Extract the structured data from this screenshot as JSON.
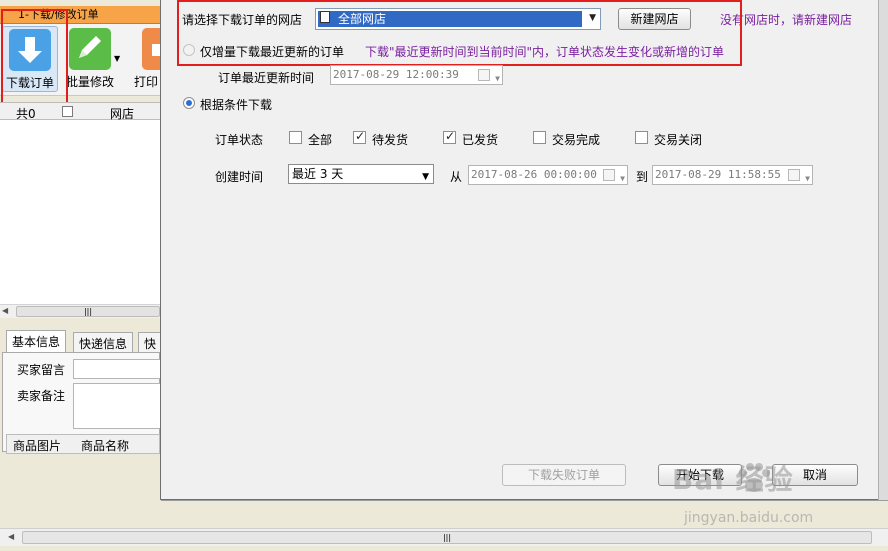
{
  "app": {
    "tab_title": "1-下载/修改订单",
    "toolbar": {
      "download_label": "下载订单",
      "batch_label": "批量修改",
      "print_label": "打印"
    },
    "list": {
      "count_label": "共0",
      "shop_col": "网店"
    },
    "info_tabs": [
      "基本信息",
      "快递信息",
      "快递"
    ],
    "info_fields": {
      "buyer_message": "买家留言",
      "seller_note": "卖家备注"
    },
    "product_cols": [
      "商品图片",
      "商品名称"
    ]
  },
  "dialog": {
    "shop_label": "请选择下载订单的网店",
    "shop_selected": "全部网店",
    "new_shop_button": "新建网店",
    "no_shop_hint": "没有网店时，请新建网店",
    "incremental_label": "仅增量下载最近更新的订单",
    "incremental_note": "下载\"最近更新时间到当前时间\"内，订单状态发生变化或新增的订单",
    "last_update_label": "订单最近更新时间",
    "last_update_value": "2017-08-29 12:00:39",
    "condition_label": "根据条件下载",
    "status_label": "订单状态",
    "statuses": [
      {
        "label": "全部",
        "checked": false
      },
      {
        "label": "待发货",
        "checked": true
      },
      {
        "label": "已发货",
        "checked": true
      },
      {
        "label": "交易完成",
        "checked": false
      },
      {
        "label": "交易关闭",
        "checked": false
      }
    ],
    "created_label": "创建时间",
    "range_value": "最近 3 天",
    "from_label": "从",
    "from_value": "2017-08-26 00:00:00",
    "to_label": "到",
    "to_value": "2017-08-29 11:58:55",
    "failed_button": "下载失败订单",
    "start_button": "开始下载",
    "cancel_button": "取消"
  },
  "watermark": {
    "logo": "Bai  经验",
    "url": "jingyan.baidu.com"
  },
  "colors": {
    "highlight_red": "#e21f1f",
    "hint_purple": "#7a1fa0",
    "selection_blue": "#316ac5"
  }
}
